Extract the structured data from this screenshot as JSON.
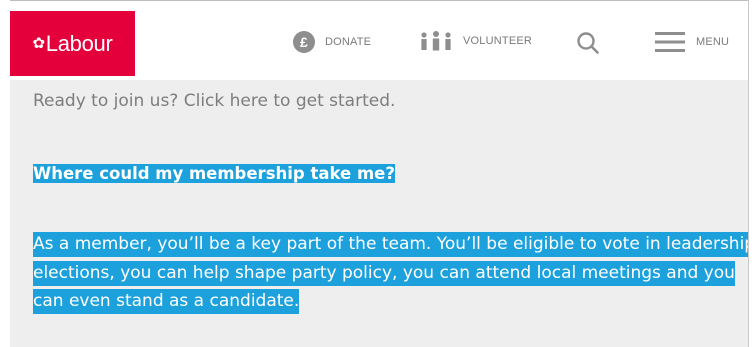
{
  "header": {
    "logo_text": "Labour",
    "logo_icon": "rose-icon",
    "donate_label": "DONATE",
    "volunteer_label": "VOLUNTEER",
    "menu_label": "MENU"
  },
  "content": {
    "intro_text": "Ready to join us? Click here to get started.",
    "question_text": "Where could my membership take me?",
    "paragraph_text": "As a member, you’ll be a key part of the team. You’ll be eligible to vote in leadership elections, you can help shape party policy, you can attend local meetings and you can even stand as a candidate."
  },
  "colors": {
    "brand": "#e4003b",
    "highlight": "#1da1dc",
    "content_bg": "#eeeeee",
    "nav_text": "#7a7a7a"
  }
}
